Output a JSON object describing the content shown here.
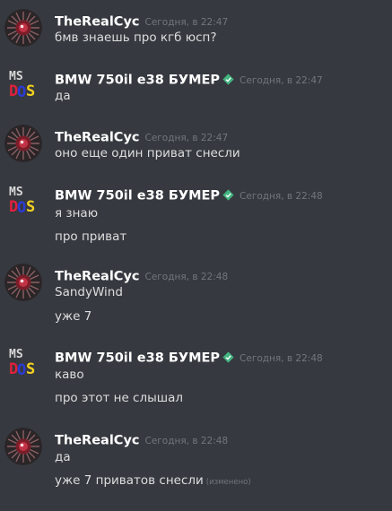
{
  "messages": [
    {
      "author": "TheRealCyc",
      "avatar": "spiky-red-ball-avatar",
      "verified": false,
      "timestamp": "Сегодня, в 22:47",
      "lines": [
        "бмв знаешь про кгб юсп?"
      ]
    },
    {
      "author": "BMW 750il e38 БУМЕР",
      "avatar": "msdos-logo-avatar",
      "verified": true,
      "timestamp": "Сегодня, в 22:47",
      "lines": [
        "да"
      ]
    },
    {
      "author": "TheRealCyc",
      "avatar": "spiky-red-ball-avatar",
      "verified": false,
      "timestamp": "Сегодня, в 22:47",
      "lines": [
        "оно еще один приват снесли"
      ]
    },
    {
      "author": "BMW 750il e38 БУМЕР",
      "avatar": "msdos-logo-avatar",
      "verified": true,
      "timestamp": "Сегодня, в 22:48",
      "lines": [
        "я знаю",
        "про приват"
      ]
    },
    {
      "author": "TheRealCyc",
      "avatar": "spiky-red-ball-avatar",
      "verified": false,
      "timestamp": "Сегодня, в 22:48",
      "lines": [
        "SandyWind",
        "уже 7"
      ]
    },
    {
      "author": "BMW 750il e38 БУМЕР",
      "avatar": "msdos-logo-avatar",
      "verified": true,
      "timestamp": "Сегодня, в 22:48",
      "lines": [
        "каво",
        "про этот не слышал"
      ]
    },
    {
      "author": "TheRealCyc",
      "avatar": "spiky-red-ball-avatar",
      "verified": false,
      "timestamp": "Сегодня, в 22:48",
      "lines": [
        "да",
        "уже 7 приватов снесли"
      ],
      "edited_label": "(изменено)"
    }
  ],
  "colors": {
    "background": "#36393f",
    "username": "#ffffff",
    "message_text": "#dcddde",
    "timestamp": "#72767d",
    "verified_badge": "#43b581"
  }
}
